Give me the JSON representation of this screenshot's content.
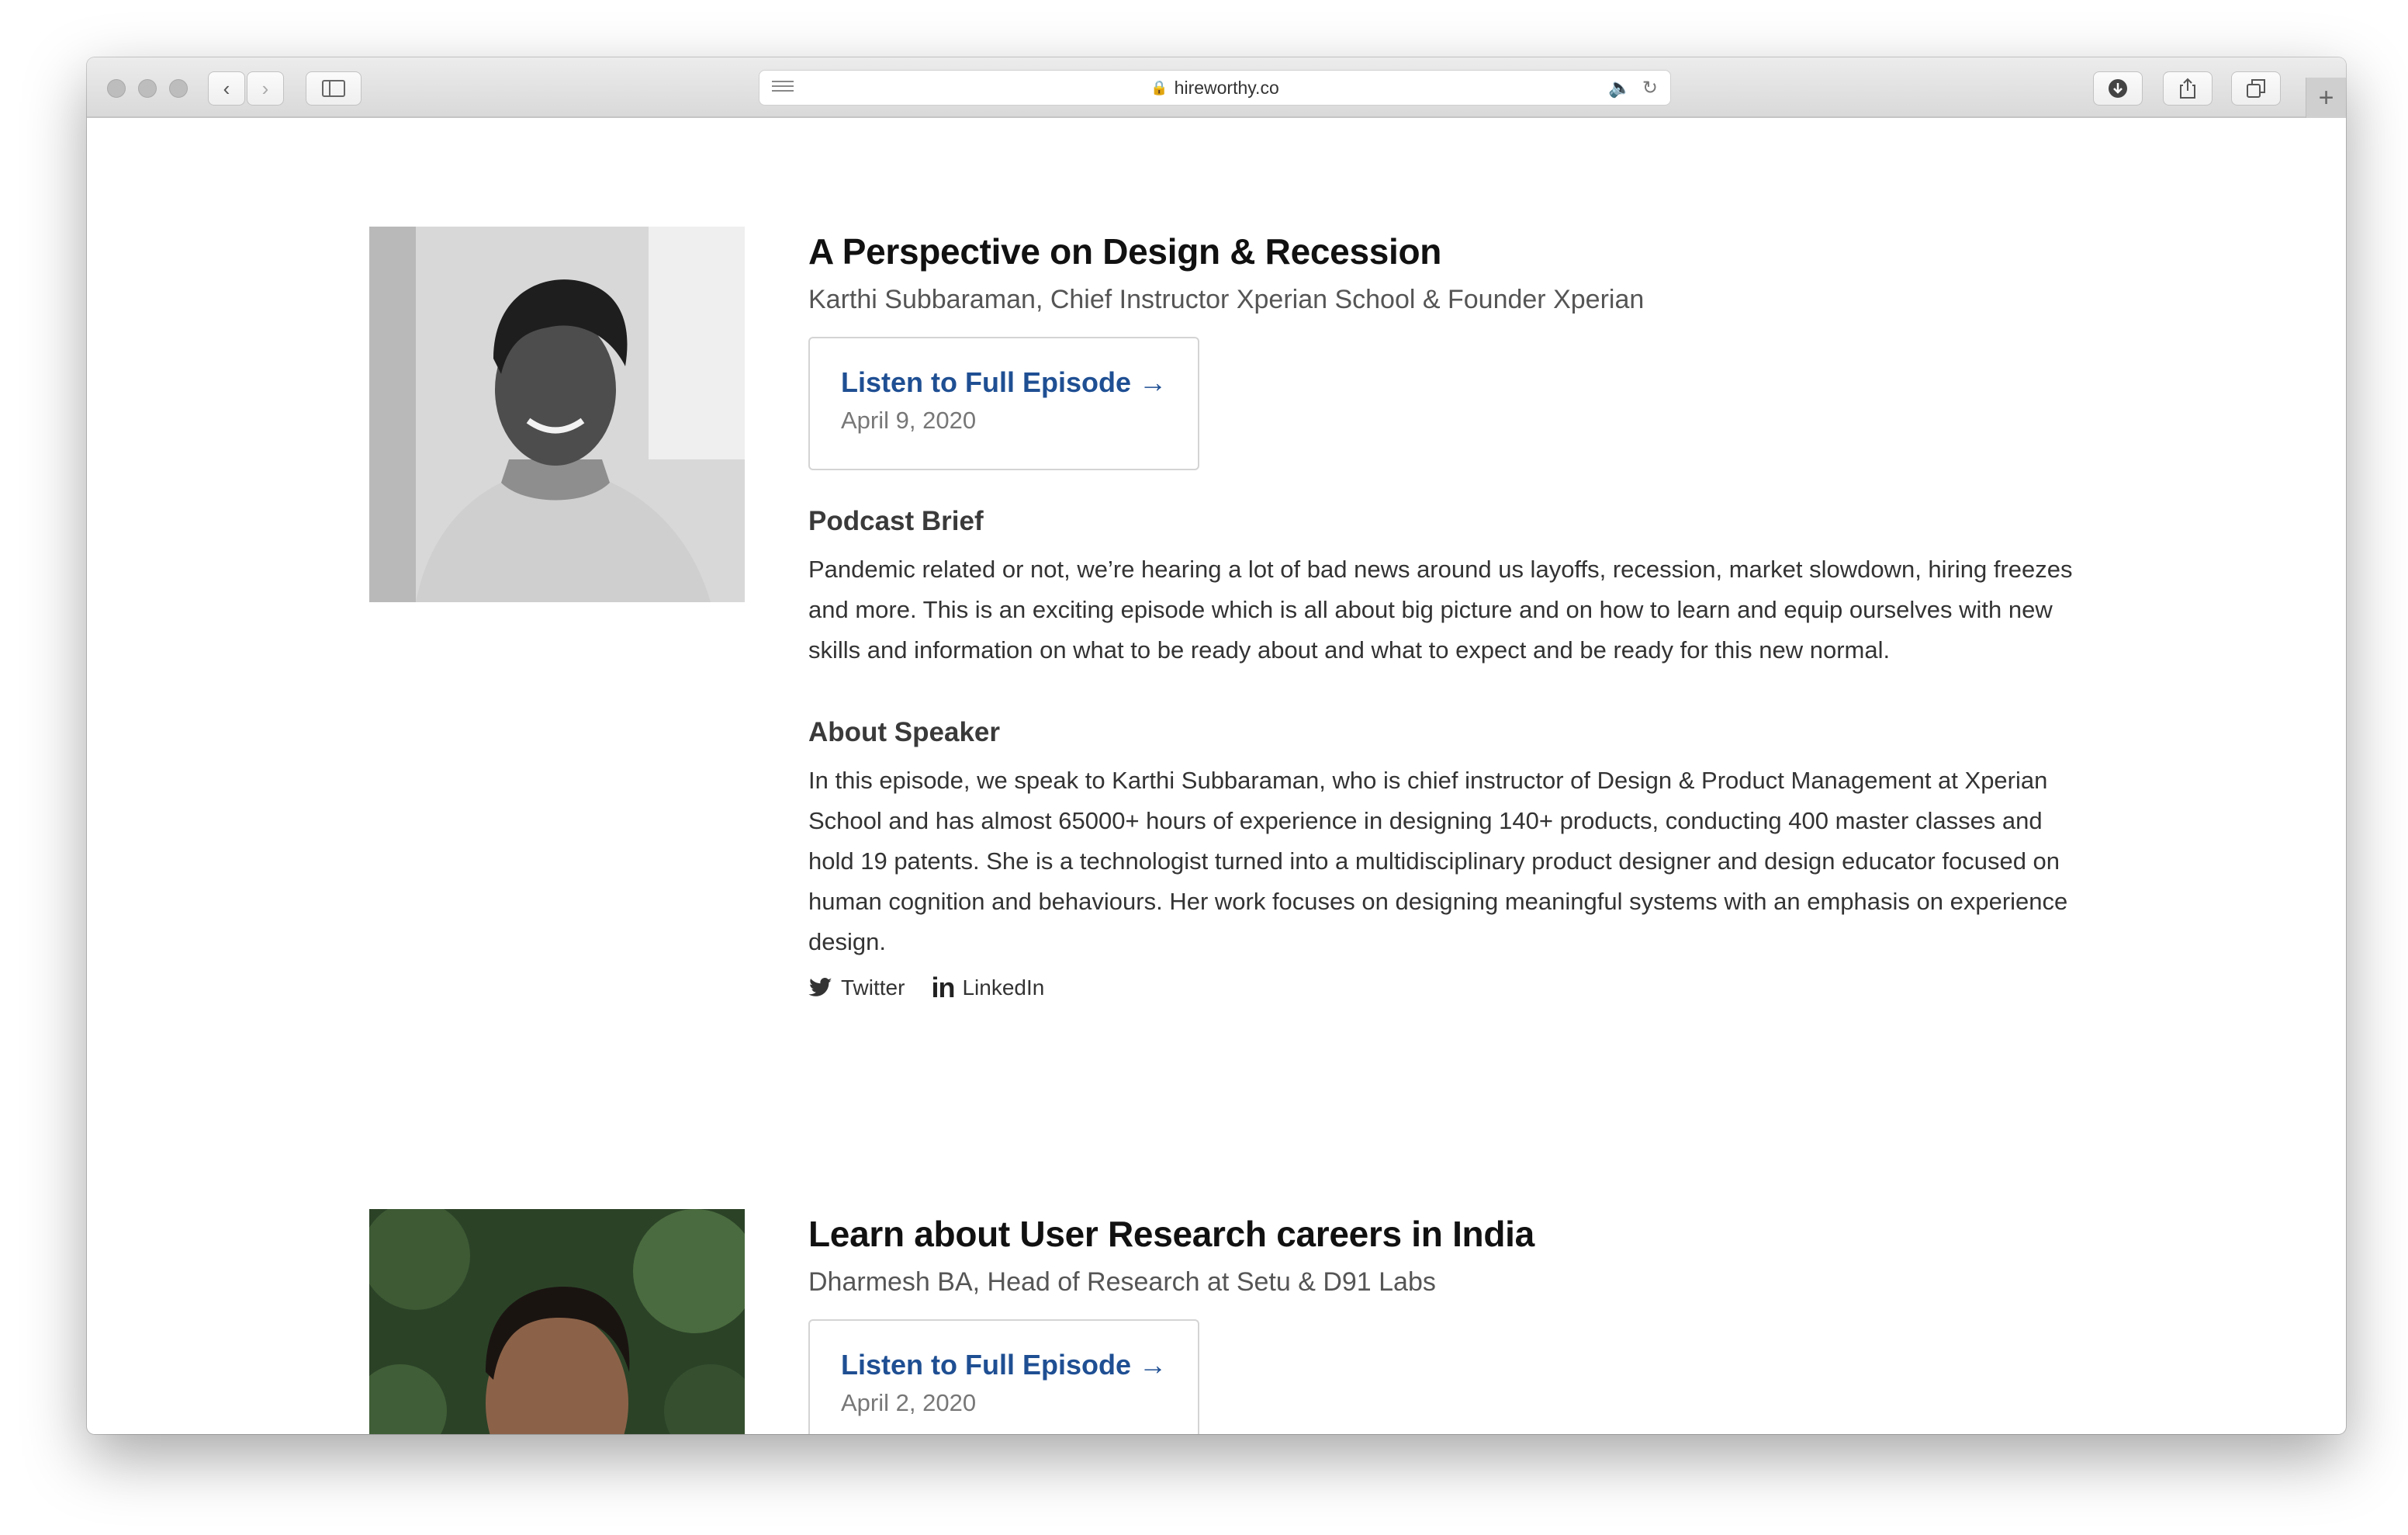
{
  "browser": {
    "url": "hireworthy.co"
  },
  "episodes": [
    {
      "title": "A Perspective on Design & Recession",
      "speaker": "Karthi Subbaraman, Chief Instructor Xperian School & Founder Xperian",
      "listen_label": "Listen to Full Episode →",
      "date": "April 9, 2020",
      "brief_heading": "Podcast Brief",
      "brief": "Pandemic related or not, we’re hearing a lot of bad news around us layoffs, recession, market slowdown, hiring freezes and more. This is an exciting episode which is all about big picture and on how to learn and equip ourselves with new skills and information on what to be ready about and what to expect and be ready for this new normal.",
      "about_heading": "About Speaker",
      "about": "In this episode, we speak to Karthi Subbaraman, who is chief instructor of Design & Product Management at Xperian School and has almost 65000+ hours of experience in designing 140+ products, conducting 400 master classes and hold 19 patents. She is a technologist turned into a multidisciplinary product designer and design educator focused on human cognition and behaviours. Her work focuses on designing meaningful systems with an emphasis on experience design.",
      "twitter_label": "Twitter",
      "linkedin_label": "LinkedIn"
    },
    {
      "title": "Learn about User Research careers in India",
      "speaker": "Dharmesh BA, Head of Research at Setu & D91 Labs",
      "listen_label": "Listen to Full Episode →",
      "date": "April 2, 2020"
    }
  ]
}
